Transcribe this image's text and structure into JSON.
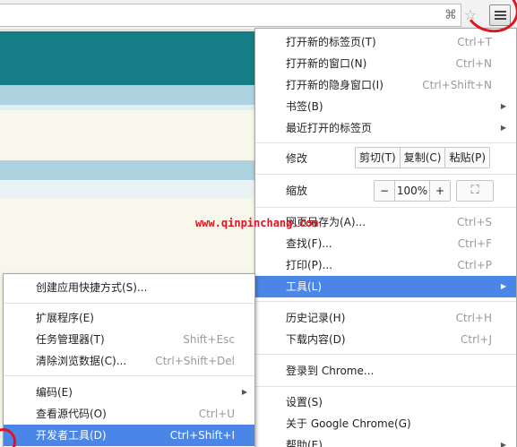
{
  "toolbar": {
    "translate_icon": "translate-icon",
    "star_icon": "bookmark-star-icon",
    "menu_icon": "hamburger-menu-icon"
  },
  "main_menu": {
    "new_tab": {
      "label": "打开新的标签页(T)",
      "shortcut": "Ctrl+T"
    },
    "new_window": {
      "label": "打开新的窗口(N)",
      "shortcut": "Ctrl+N"
    },
    "new_incognito": {
      "label": "打开新的隐身窗口(I)",
      "shortcut": "Ctrl+Shift+N"
    },
    "bookmarks": {
      "label": "书签(B)"
    },
    "recent_tabs": {
      "label": "最近打开的标签页"
    },
    "edit": {
      "label": "修改",
      "cut": "剪切(T)",
      "copy": "复制(C)",
      "paste": "粘贴(P)"
    },
    "zoom": {
      "label": "缩放",
      "minus": "−",
      "value": "100%",
      "plus": "+",
      "fullscreen_icon": "fullscreen-icon"
    },
    "save_as": {
      "label": "网页另存为(A)...",
      "shortcut": "Ctrl+S"
    },
    "find": {
      "label": "查找(F)...",
      "shortcut": "Ctrl+F"
    },
    "print": {
      "label": "打印(P)...",
      "shortcut": "Ctrl+P"
    },
    "tools": {
      "label": "工具(L)"
    },
    "history": {
      "label": "历史记录(H)",
      "shortcut": "Ctrl+H"
    },
    "downloads": {
      "label": "下载内容(D)",
      "shortcut": "Ctrl+J"
    },
    "sign_in": {
      "label": "登录到 Chrome..."
    },
    "settings": {
      "label": "设置(S)"
    },
    "about": {
      "label": "关于 Google Chrome(G)"
    },
    "help": {
      "label": "帮助(E)"
    }
  },
  "tools_submenu": {
    "create_shortcuts": {
      "label": "创建应用快捷方式(S)..."
    },
    "extensions": {
      "label": "扩展程序(E)"
    },
    "task_manager": {
      "label": "任务管理器(T)",
      "shortcut": "Shift+Esc"
    },
    "clear_data": {
      "label": "清除浏览数据(C)...",
      "shortcut": "Ctrl+Shift+Del"
    },
    "encoding": {
      "label": "编码(E)"
    },
    "view_source": {
      "label": "查看源代码(O)",
      "shortcut": "Ctrl+U"
    },
    "devtools": {
      "label": "开发者工具(D)",
      "shortcut": "Ctrl+Shift+I"
    }
  },
  "watermark": "www.qinpinchang.com",
  "colors": {
    "highlight": "#4a86e8",
    "page_teal": "#157d85",
    "page_lightblue": "#acd3df",
    "annotation_red": "#e0141e"
  }
}
